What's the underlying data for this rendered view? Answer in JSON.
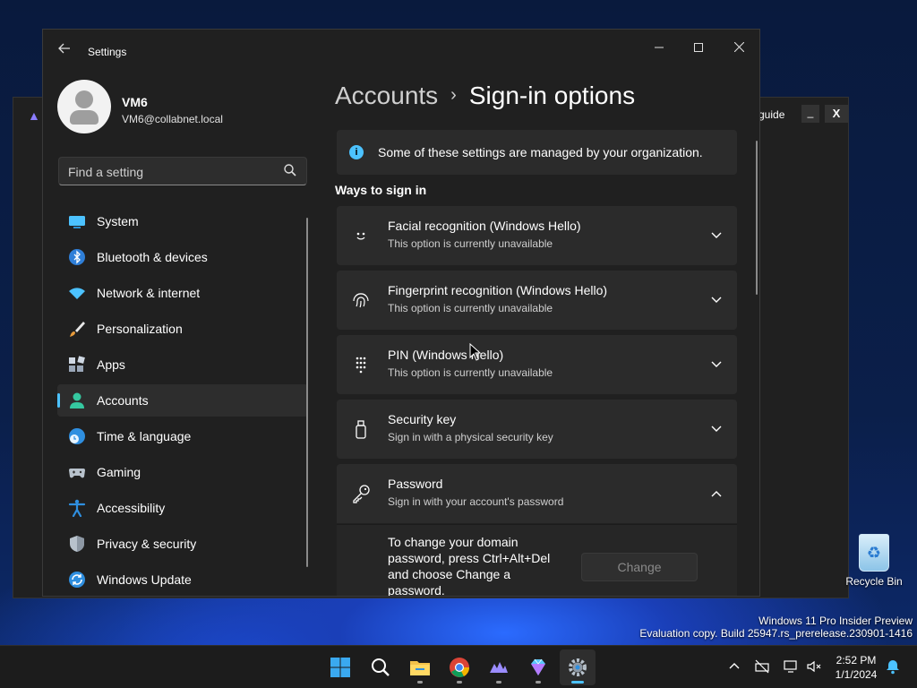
{
  "background_window": {
    "guide_label": "guide",
    "minimize_label": "_",
    "close_label": "X"
  },
  "desktop": {
    "recycle_bin_label": "Recycle Bin",
    "watermark_line1": "Windows 11 Pro Insider Preview",
    "watermark_line2": "Evaluation copy. Build 25947.rs_prerelease.230901-1416"
  },
  "settings": {
    "window_title": "Settings",
    "user": {
      "name": "VM6",
      "email": "VM6@collabnet.local"
    },
    "search": {
      "placeholder": "Find a setting"
    },
    "nav": [
      {
        "label": "System",
        "icon": "system-icon"
      },
      {
        "label": "Bluetooth & devices",
        "icon": "bluetooth-icon"
      },
      {
        "label": "Network & internet",
        "icon": "wifi-icon"
      },
      {
        "label": "Personalization",
        "icon": "brush-icon"
      },
      {
        "label": "Apps",
        "icon": "apps-icon"
      },
      {
        "label": "Accounts",
        "icon": "person-icon",
        "active": true
      },
      {
        "label": "Time & language",
        "icon": "globe-clock-icon"
      },
      {
        "label": "Gaming",
        "icon": "gamepad-icon"
      },
      {
        "label": "Accessibility",
        "icon": "accessibility-icon"
      },
      {
        "label": "Privacy & security",
        "icon": "shield-icon"
      },
      {
        "label": "Windows Update",
        "icon": "update-icon"
      }
    ],
    "breadcrumb": {
      "parent": "Accounts",
      "separator": "›",
      "current": "Sign-in options"
    },
    "info_message": "Some of these settings are managed by your organization.",
    "section_title": "Ways to sign in",
    "options": [
      {
        "title": "Facial recognition (Windows Hello)",
        "subtitle": "This option is currently unavailable",
        "icon": "face-icon",
        "expanded": false
      },
      {
        "title": "Fingerprint recognition (Windows Hello)",
        "subtitle": "This option is currently unavailable",
        "icon": "fingerprint-icon",
        "expanded": false
      },
      {
        "title": "PIN (Windows Hello)",
        "subtitle": "This option is currently unavailable",
        "icon": "pin-keypad-icon",
        "expanded": false
      },
      {
        "title": "Security key",
        "subtitle": "Sign in with a physical security key",
        "icon": "usb-key-icon",
        "expanded": false
      },
      {
        "title": "Password",
        "subtitle": "Sign in with your account's password",
        "icon": "key-icon",
        "expanded": true
      }
    ],
    "password_panel": {
      "text": "To change your domain password, press Ctrl+Alt+Del and choose Change a password.",
      "button_label": "Change"
    }
  },
  "taskbar": {
    "apps": [
      "start-icon",
      "search-icon",
      "file-explorer-icon",
      "chrome-icon",
      "app-logo-icon",
      "gem-app-icon",
      "settings-icon"
    ],
    "clock_time": "2:52 PM",
    "clock_date": "1/1/2024"
  },
  "colors": {
    "accent": "#4cc2ff",
    "window_bg": "#202020",
    "card_bg": "#2b2b2b"
  }
}
